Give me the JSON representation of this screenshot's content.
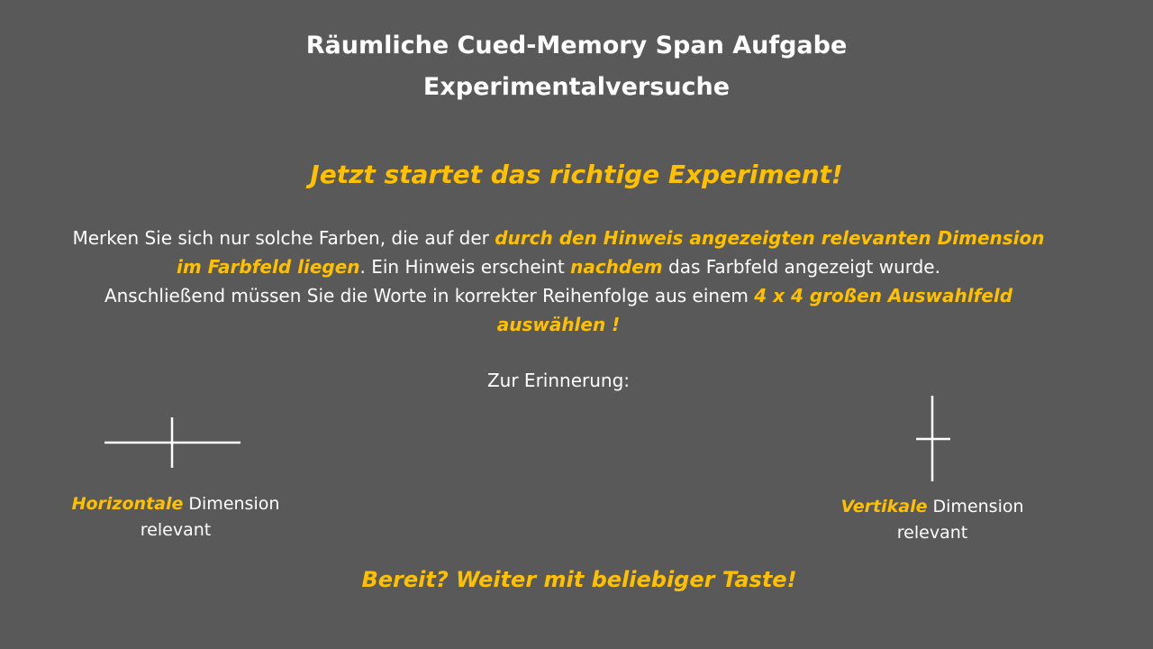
{
  "title": {
    "line1": "Räumliche Cued-Memory Span Aufgabe",
    "line2": "Experimentalversuche"
  },
  "headline": "Jetzt startet das richtige Experiment!",
  "instructions": {
    "p1_plain": "Merken Sie sich nur solche Farben, die auf der ",
    "p1_accent_a": "durch den Hinweis angezeigten relevanten Dimension",
    "p2_accent_b": "im Farbfeld liegen",
    "p2_plain": ". Ein Hinweis erscheint ",
    "p2_accent_c": "nachdem",
    "p2_plain_b": " das Farbfeld angezeigt wurde.",
    "p3_plain": "Anschließend müssen Sie die Worte in korrekter Reihenfolge aus einem ",
    "p3_accent": "4 x 4 großen Auswahlfeld",
    "p4_accent": "auswählen !"
  },
  "reminder_label": "Zur Erinnerung:",
  "horizontal_cue": {
    "icon": "horizontal-cross-icon",
    "accent_word": "Horizontale",
    "rest": " Dimension",
    "line2": "relevant"
  },
  "vertical_cue": {
    "icon": "vertical-cross-icon",
    "accent_word": "Vertikale",
    "rest": " Dimension",
    "line2": "relevant"
  },
  "prompt": "Bereit? Weiter mit beliebiger Taste!",
  "colors": {
    "background": "#595959",
    "text": "#ffffff",
    "accent": "#ffc000"
  }
}
